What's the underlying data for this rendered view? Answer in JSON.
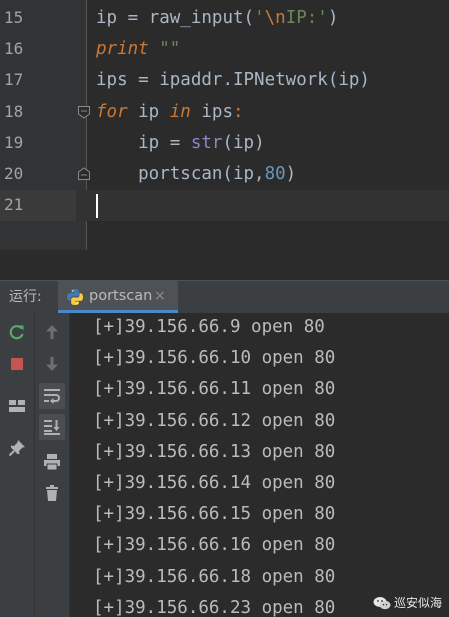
{
  "editor": {
    "lines": [
      {
        "number": "15",
        "tokens": [
          {
            "t": "ip ",
            "c": "plain"
          },
          {
            "t": "=",
            "c": "op"
          },
          {
            "t": " raw_input(",
            "c": "plain"
          },
          {
            "t": "'",
            "c": "str"
          },
          {
            "t": "\\n",
            "c": "escape"
          },
          {
            "t": "IP:'",
            "c": "str"
          },
          {
            "t": ")",
            "c": "plain"
          }
        ]
      },
      {
        "number": "16",
        "tokens": [
          {
            "t": "print",
            "c": "kw"
          },
          {
            "t": " \"\"",
            "c": "str"
          }
        ]
      },
      {
        "number": "17",
        "tokens": [
          {
            "t": "ips ",
            "c": "plain"
          },
          {
            "t": "=",
            "c": "op"
          },
          {
            "t": " ipaddr.IPNetwork(ip)",
            "c": "plain"
          }
        ]
      },
      {
        "number": "18",
        "tokens": [
          {
            "t": "for",
            "c": "kw"
          },
          {
            "t": " ip ",
            "c": "plain"
          },
          {
            "t": "in",
            "c": "kw"
          },
          {
            "t": " ips",
            "c": "plain"
          },
          {
            "t": ":",
            "c": "escape"
          }
        ]
      },
      {
        "number": "19",
        "tokens": [
          {
            "t": "    ip ",
            "c": "plain"
          },
          {
            "t": "=",
            "c": "op"
          },
          {
            "t": " ",
            "c": "plain"
          },
          {
            "t": "str",
            "c": "builtin"
          },
          {
            "t": "(ip)",
            "c": "plain"
          }
        ]
      },
      {
        "number": "20",
        "tokens": [
          {
            "t": "    portscan(ip,",
            "c": "plain"
          },
          {
            "t": "80",
            "c": "num"
          },
          {
            "t": ")",
            "c": "plain"
          }
        ]
      },
      {
        "number": "21",
        "tokens": []
      }
    ],
    "current_line": "21"
  },
  "run_panel": {
    "label": "运行:",
    "tab_label": "portscan",
    "tab_close": "×",
    "output": [
      "[+]39.156.66.9 open 80",
      "[+]39.156.66.10 open 80",
      "[+]39.156.66.11 open 80",
      "[+]39.156.66.12 open 80",
      "[+]39.156.66.13 open 80",
      "[+]39.156.66.14 open 80",
      "[+]39.156.66.15 open 80",
      "[+]39.156.66.16 open 80",
      "[+]39.156.66.18 open 80",
      "[+]39.156.66.23 open 80"
    ]
  },
  "toolbar": {
    "left": [
      "rerun-icon",
      "stop-icon",
      "layout-icon",
      "pin-icon"
    ],
    "second": [
      "up-arrow-icon",
      "down-arrow-icon",
      "soft-wrap-icon",
      "scroll-to-end-icon",
      "print-icon",
      "trash-icon"
    ]
  },
  "watermark": {
    "text": "巡安似海"
  },
  "colors": {
    "editor_bg": "#2b2b2b",
    "gutter_bg": "#313335",
    "panel_bg": "#3c3f41",
    "keyword": "#cc7832",
    "string": "#6a8759",
    "number": "#6897bb",
    "builtin": "#8888c6",
    "text": "#a9b7c6",
    "accent": "#4a88c7"
  }
}
